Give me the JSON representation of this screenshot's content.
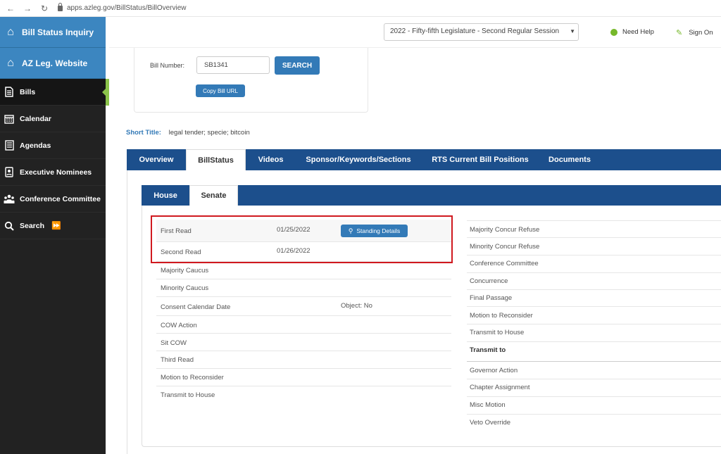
{
  "browser": {
    "url": "apps.azleg.gov/BillStatus/BillOverview"
  },
  "sidebar": {
    "top_items": [
      {
        "label": "Bill Status Inquiry",
        "icon": "home-icon"
      },
      {
        "label": "AZ Leg. Website",
        "icon": "home-icon"
      }
    ],
    "items": [
      {
        "label": "Bills",
        "icon": "document-icon",
        "active": true
      },
      {
        "label": "Calendar",
        "icon": "calendar-icon"
      },
      {
        "label": "Agendas",
        "icon": "list-icon"
      },
      {
        "label": "Executive Nominees",
        "icon": "nominee-icon"
      },
      {
        "label": "Conference Committee",
        "icon": "group-icon"
      },
      {
        "label": "Search",
        "icon": "search-icon"
      }
    ]
  },
  "header": {
    "session": "2022 - Fifty-fifth Legislature - Second Regular Session",
    "help_label": "Need Help",
    "sign_label": "Sign On"
  },
  "search": {
    "bill_label": "Bill Number:",
    "bill_value": "SB1341",
    "search_label": "SEARCH",
    "copy_label": "Copy Bill URL"
  },
  "short_title": {
    "label": "Short Title:",
    "value": "legal tender; specie; bitcoin"
  },
  "tabs": [
    {
      "label": "Overview"
    },
    {
      "label": "BillStatus",
      "active": true
    },
    {
      "label": "Videos"
    },
    {
      "label": "Sponsor/Keywords/Sections"
    },
    {
      "label": "RTS Current Bill Positions"
    },
    {
      "label": "Documents"
    }
  ],
  "sub_tabs": [
    {
      "label": "House"
    },
    {
      "label": "Senate",
      "active": true
    }
  ],
  "status_left": [
    {
      "label": "First Read",
      "value": "01/25/2022"
    },
    {
      "label": "Second Read",
      "value": "01/26/2022"
    },
    {
      "label": "Majority Caucus",
      "value": ""
    },
    {
      "label": "Minority Caucus",
      "value": ""
    },
    {
      "label": "Consent Calendar Date",
      "value": "Object: No"
    },
    {
      "label": "COW Action",
      "value": ""
    },
    {
      "label": "Sit COW",
      "value": ""
    },
    {
      "label": "Third Read",
      "value": ""
    },
    {
      "label": "Motion to Reconsider",
      "value": ""
    },
    {
      "label": "Transmit to House",
      "value": ""
    }
  ],
  "status_right": [
    {
      "label": "Majority Concur Refuse"
    },
    {
      "label": "Minority Concur Refuse"
    },
    {
      "label": "Conference Committee"
    },
    {
      "label": "Concurrence"
    },
    {
      "label": "Final Passage"
    },
    {
      "label": "Motion to Reconsider"
    },
    {
      "label": "Transmit to House"
    },
    {
      "label": "Transmit to",
      "bold": true
    },
    {
      "label": "Governor Action"
    },
    {
      "label": "Chapter Assignment"
    },
    {
      "label": "Misc Motion"
    },
    {
      "label": "Veto Override"
    }
  ],
  "details_button": "Standing Details"
}
